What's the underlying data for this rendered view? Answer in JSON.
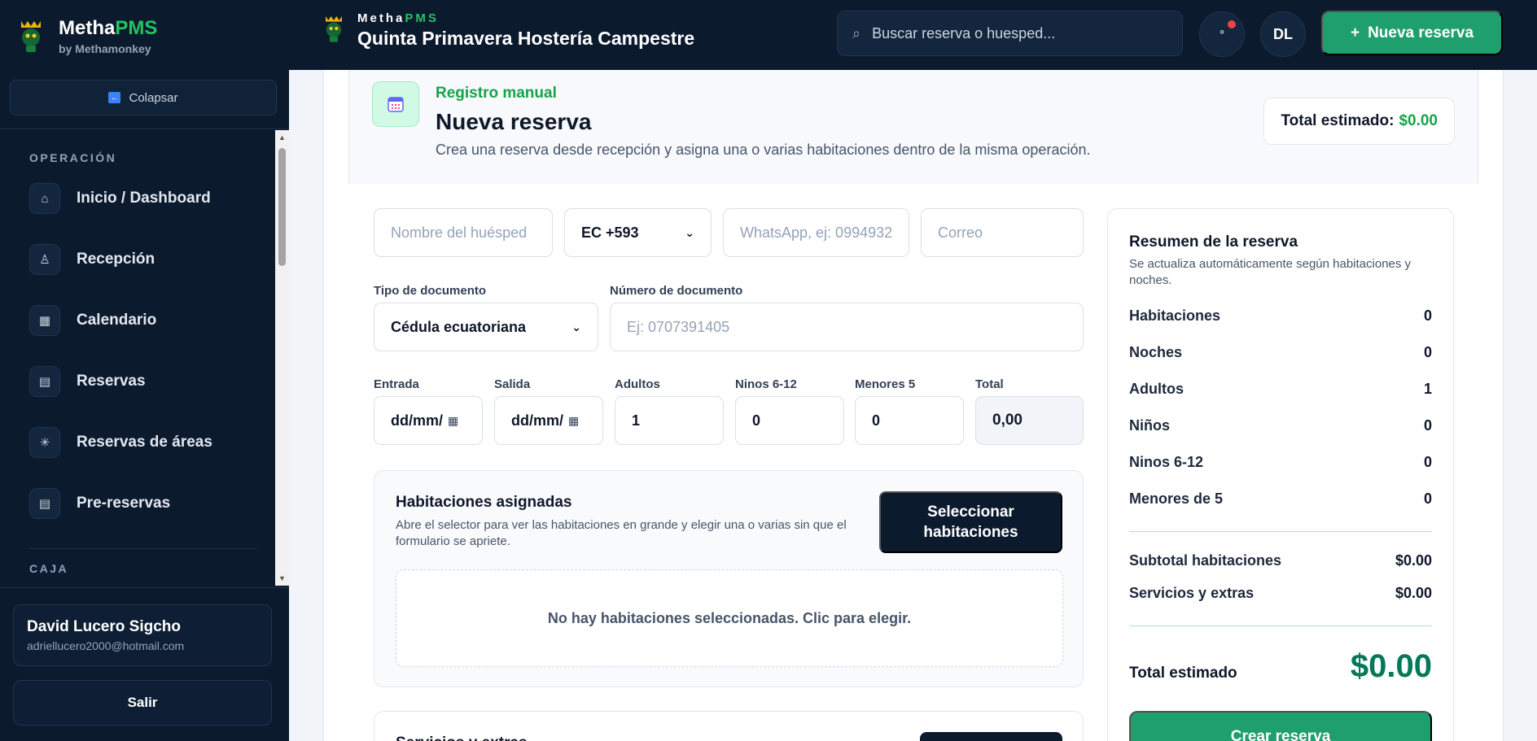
{
  "sidebar": {
    "brand": {
      "name_a": "Metha",
      "name_b": "PMS",
      "sub": "by Methamonkey"
    },
    "collapse_label": "Colapsar",
    "sections": {
      "operacion": "OPERACIÓN",
      "caja": "CAJA"
    },
    "items": [
      {
        "label": "Inicio / Dashboard",
        "icon": "home-icon"
      },
      {
        "label": "Recepción",
        "icon": "bell-icon"
      },
      {
        "label": "Calendario",
        "icon": "calendar-icon"
      },
      {
        "label": "Reservas",
        "icon": "document-icon"
      },
      {
        "label": "Reservas de áreas",
        "icon": "sparkle-icon"
      },
      {
        "label": "Pre-reservas",
        "icon": "document-icon"
      }
    ],
    "user": {
      "name": "David Lucero Sigcho",
      "email": "adriellucero2000@hotmail.com"
    },
    "logout_label": "Salir"
  },
  "topbar": {
    "brand_a": "Metha",
    "brand_b": "PMS",
    "hotel": "Quinta Primavera Hostería Campestre",
    "search_placeholder": "Buscar reserva o huesped...",
    "notif_glyph": "°",
    "avatar": "DL",
    "new_label": "Nueva reserva",
    "new_glyph": "+"
  },
  "header": {
    "kicker": "Registro manual",
    "title": "Nueva reserva",
    "desc": "Crea una reserva desde recepción y asigna una o varias habitaciones dentro de la misma operación.",
    "total_label": "Total estimado:",
    "total_value": "$0.00"
  },
  "form": {
    "guest_placeholder": "Nombre del huésped",
    "phone_code": "EC +593",
    "whatsapp_placeholder": "WhatsApp, ej: 0994932",
    "email_placeholder": "Correo",
    "doc_type_label": "Tipo de documento",
    "doc_type_value": "Cédula ecuatoriana",
    "doc_number_label": "Número de documento",
    "doc_number_placeholder": "Ej: 0707391405",
    "entrada_label": "Entrada",
    "entrada_value": "dd/mm/",
    "salida_label": "Salida",
    "salida_value": "dd/mm/",
    "adultos_label": "Adultos",
    "adultos_value": "1",
    "ninos_label": "Ninos 6-12",
    "ninos_value": "0",
    "menores_label": "Menores 5",
    "menores_value": "0",
    "total_label": "Total",
    "total_value": "0,00"
  },
  "rooms": {
    "title": "Habitaciones asignadas",
    "desc": "Abre el selector para ver las habitaciones en grande y elegir una o varias sin que el formulario se apriete.",
    "button": "Seleccionar habitaciones",
    "empty": "No hay habitaciones seleccionadas. Clic para elegir."
  },
  "services": {
    "title": "Servicios y extras"
  },
  "summary": {
    "title": "Resumen de la reserva",
    "sub": "Se actualiza automáticamente según habitaciones y noches.",
    "rows": [
      {
        "label": "Habitaciones",
        "value": "0"
      },
      {
        "label": "Noches",
        "value": "0"
      },
      {
        "label": "Adultos",
        "value": "1"
      },
      {
        "label": "Niños",
        "value": "0"
      },
      {
        "label": "Ninos 6-12",
        "value": "0"
      },
      {
        "label": "Menores de 5",
        "value": "0"
      }
    ],
    "subtotal_label": "Subtotal habitaciones",
    "subtotal_value": "$0.00",
    "services_label": "Servicios y extras",
    "services_value": "$0.00",
    "total_label": "Total estimado",
    "total_value": "$0.00",
    "create_label": "Crear reserva"
  },
  "colors": {
    "accent": "#1f9e6e",
    "brand_green": "#22c55e",
    "sidebar_bg": "#0c1a2e",
    "notif": "#ef4444"
  }
}
